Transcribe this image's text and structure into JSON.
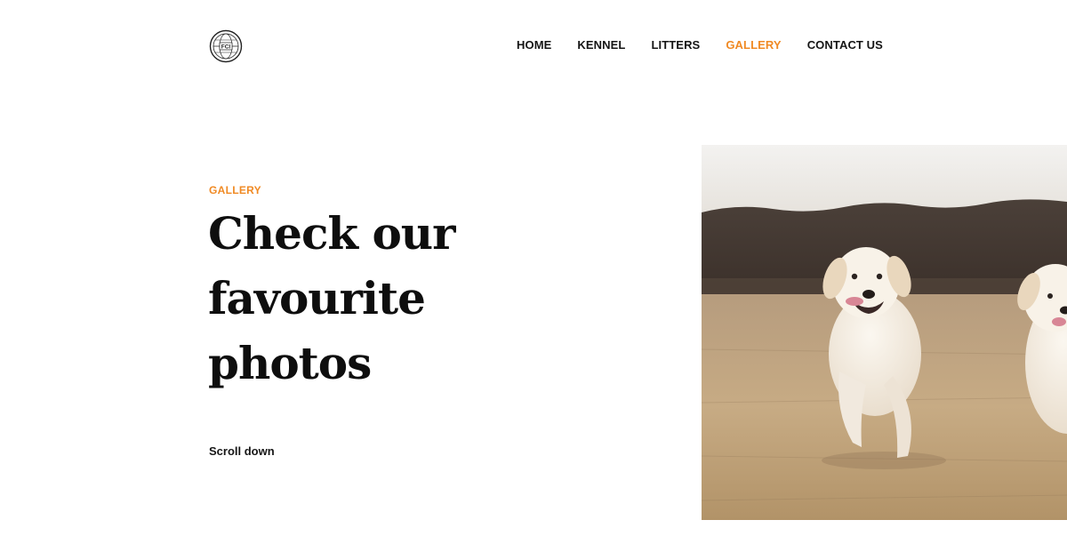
{
  "header": {
    "logo_alt": "FCI",
    "nav": [
      {
        "label": "HOME",
        "active": false
      },
      {
        "label": "KENNEL",
        "active": false
      },
      {
        "label": "LITTERS",
        "active": false
      },
      {
        "label": "GALLERY",
        "active": true
      },
      {
        "label": "CONTACT US",
        "active": false
      }
    ]
  },
  "hero": {
    "eyebrow": "GALLERY",
    "headline_lines": [
      "Check our",
      "favourite",
      "photos"
    ],
    "scroll_label": "Scroll down"
  },
  "colors": {
    "accent": "#f08a24",
    "text": "#111111",
    "background": "#ffffff"
  },
  "image": {
    "subject": "two white golden retrievers running in a field"
  }
}
